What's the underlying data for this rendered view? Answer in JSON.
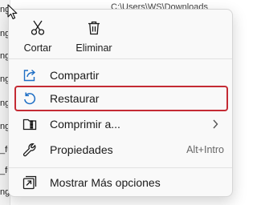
{
  "background": {
    "path_text": "C:\\Users\\WS\\Downloads",
    "left_fragments": [
      "ng",
      "ng",
      "ng",
      "ng",
      "ng",
      "ng",
      "_fu",
      "_fu",
      "ng"
    ]
  },
  "menu": {
    "quick_actions": [
      {
        "label": "Cortar",
        "icon": "scissors-icon"
      },
      {
        "label": "Eliminar",
        "icon": "trash-icon"
      }
    ],
    "items": [
      {
        "label": "Compartir",
        "icon": "share-icon",
        "shortcut": ""
      },
      {
        "label": "Restaurar",
        "icon": "restore-icon",
        "shortcut": "",
        "selected": true
      },
      {
        "label": "Comprimir a...",
        "icon": "compress-icon",
        "shortcut": "",
        "submenu": true
      },
      {
        "label": "Propiedades",
        "icon": "wrench-icon",
        "shortcut": "Alt+Intro"
      },
      {
        "label": "Mostrar Más opciones",
        "icon": "more-options-icon",
        "shortcut": ""
      }
    ],
    "colors": {
      "selection_border": "#c42b34",
      "icon_accent": "#1f6fc5"
    }
  }
}
